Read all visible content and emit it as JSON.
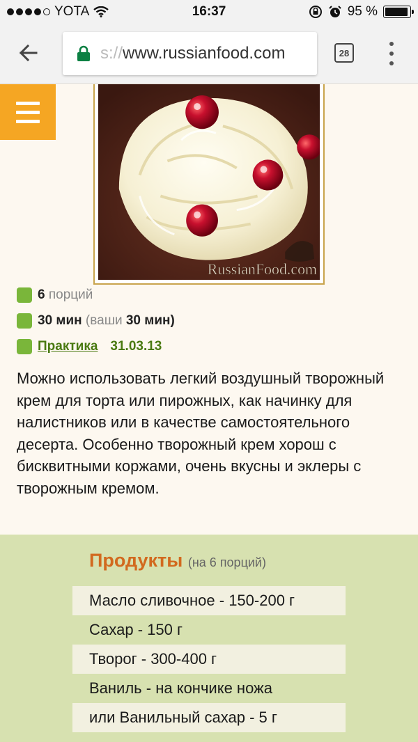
{
  "status_bar": {
    "carrier": "YOTA",
    "time": "16:37",
    "battery_text": "95 %",
    "battery_level": 0.95
  },
  "browser": {
    "url_prefix": "s://",
    "url_domain": "www.russianfood.com",
    "tab_count": "28"
  },
  "photo": {
    "watermark": "RussianFood.com"
  },
  "recipe": {
    "servings_value": "6",
    "servings_label": "порций",
    "time_value": "30",
    "time_unit": "мин",
    "time_yours_prefix": "(ваши",
    "time_yours_value": "30",
    "time_yours_unit": "мин)",
    "author": "Практика",
    "date": "31.03.13",
    "description": "Можно использовать легкий воздушный творожный крем для торта или пирожных, как начинку для налистников или в качестве самостоятельного десерта. Особенно творожный крем хорош с бисквитными коржами, очень вкусны и эклеры с творожным кремом."
  },
  "products": {
    "title": "Продукты",
    "portions": "(на 6 порций)",
    "items": [
      "Масло сливочное - 150-200 г",
      "Сахар - 150 г",
      "Творог - 300-400 г",
      "Ваниль - на кончике ножа",
      "или Ванильный сахар - 5 г"
    ]
  },
  "colors": {
    "accent_orange": "#f5a623",
    "products_bg": "#d7e1b0",
    "title_orange": "#d2691e",
    "link_green": "#4a7a12"
  }
}
